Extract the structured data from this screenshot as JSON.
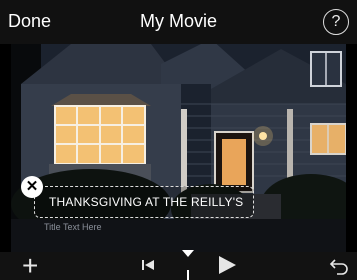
{
  "header": {
    "done_label": "Done",
    "title": "My Movie",
    "help_label": "?"
  },
  "title_overlay": {
    "text": "THANKSGIVING AT THE REILLY'S",
    "placeholder": "Title Text Here"
  },
  "toolbar": {
    "add_label": "+",
    "colors": {
      "bar": "#121212",
      "icon": "#e6e6e6"
    }
  }
}
